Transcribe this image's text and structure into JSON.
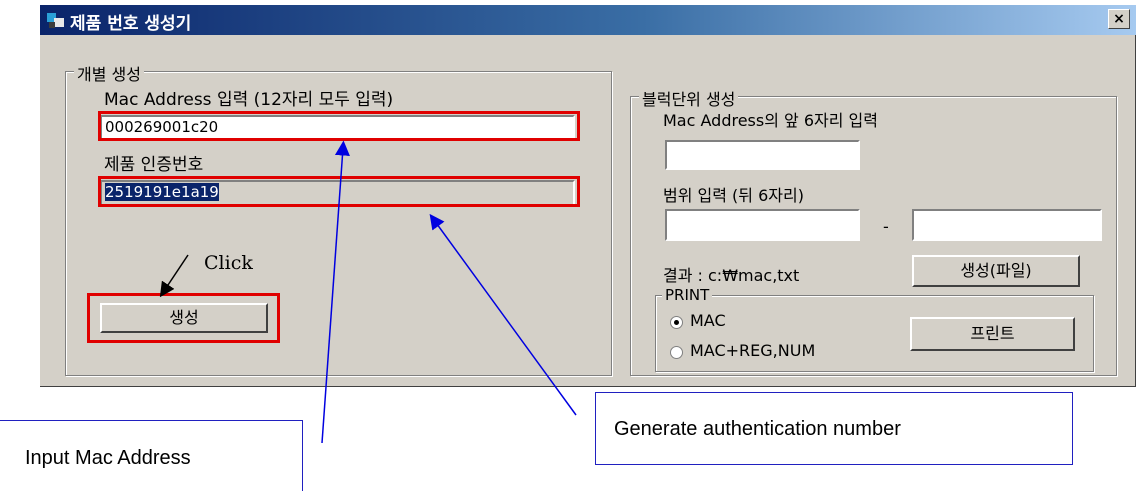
{
  "window": {
    "title": "제품 번호 생성기",
    "close_label": "×"
  },
  "individual": {
    "group_label": "개별 생성",
    "mac_label": "Mac Address 입력 (12자리 모두 입력)",
    "mac_value": "000269001c20",
    "auth_label": "제품 인증번호",
    "auth_value": "2519191e1a19",
    "generate_button": "생성"
  },
  "block": {
    "group_label": "블럭단위 생성",
    "mac_prefix_label": "Mac Address의 앞 6자리 입력",
    "mac_prefix_value": "",
    "range_label": "범위 입력 (뒤 6자리)",
    "range_start": "",
    "range_dash": "-",
    "range_end": "",
    "result_label": "결과 : c:₩mac,txt",
    "generate_file_button": "생성(파일)",
    "print": {
      "group_label": "PRINT",
      "options": [
        "MAC",
        "MAC+REG,NUM"
      ],
      "selected": "MAC",
      "print_button": "프린트"
    }
  },
  "annotations": {
    "click": "Click",
    "input_mac": "Input Mac Address",
    "generate_auth": "Generate authentication number",
    "colors": {
      "highlight": "#e00000",
      "arrow": "#0000e0"
    }
  }
}
